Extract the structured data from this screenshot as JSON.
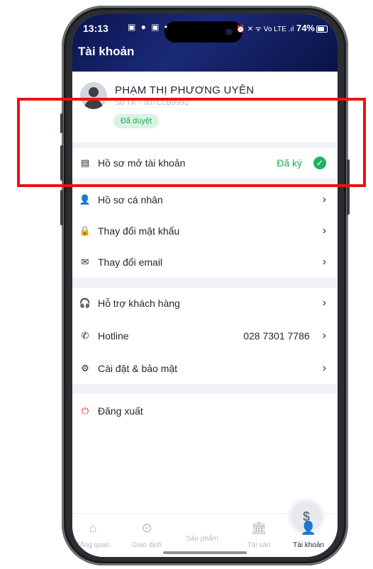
{
  "status_bar": {
    "time": "13:13",
    "battery": "74%",
    "notif_icons": "▣ ● ▣ •",
    "sys_icons": "⏰ ✕ ᯤ Vo LTE .ıl"
  },
  "header": {
    "title": "Tài khoản"
  },
  "profile": {
    "name": "PHẠM THỊ PHƯƠNG UYÊN",
    "account": "Số TK - 907CLB9992",
    "status_badge": "Đã duyệt"
  },
  "account_opening": {
    "label": "Hồ sơ mở tài khoản",
    "status": "Đã ký"
  },
  "menu_group_1": [
    {
      "label": "Hồ sơ cá nhân",
      "icon": "user-icon"
    },
    {
      "label": "Thay đổi mật khẩu",
      "icon": "lock-icon"
    },
    {
      "label": "Thay đổi email",
      "icon": "mail-icon"
    }
  ],
  "menu_group_2": [
    {
      "label": "Hỗ trợ khách hàng",
      "icon": "headset-icon"
    },
    {
      "label": "Hotline",
      "icon": "phone-icon",
      "value": "028 7301 7786"
    },
    {
      "label": "Cài đặt & bảo mật",
      "icon": "gear-icon"
    }
  ],
  "logout": {
    "label": "Đăng xuất"
  },
  "tabbar": [
    {
      "label": "Tổng quan",
      "icon": "home-icon"
    },
    {
      "label": "Giao dịch",
      "icon": "exchange-icon"
    },
    {
      "label": "Sản phẩm",
      "icon": "product-icon"
    },
    {
      "label": "Tài sản",
      "icon": "bank-icon"
    },
    {
      "label": "Tài khoản",
      "icon": "account-icon",
      "active": true
    }
  ],
  "colors": {
    "accent_green": "#1fa85a",
    "logout_red": "#e02b2b",
    "header_navy": "#0b1450",
    "highlight_red": "#ee1111"
  }
}
